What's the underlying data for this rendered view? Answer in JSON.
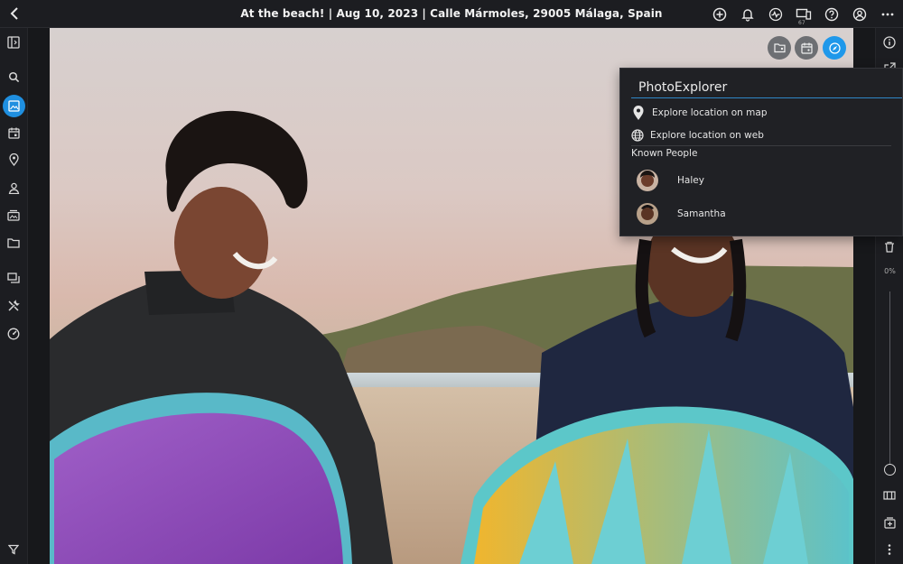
{
  "header": {
    "title": "At the beach! | Aug 10, 2023 | Calle Mármoles, 29005 Málaga, Spain",
    "upload_badge": "67",
    "icons": [
      "chevron-left-icon",
      "add-circle-icon",
      "bell-icon",
      "activity-icon",
      "devices-icon",
      "help-icon",
      "account-icon",
      "more-horizontal-icon"
    ]
  },
  "left_sidebar": {
    "items": [
      "sidebar-toggle-icon",
      "search-icon",
      "photos-icon",
      "calendar-icon",
      "places-icon",
      "people-icon",
      "albums-icon",
      "folder-icon",
      "library-icon",
      "tools-icon",
      "dashboard-icon",
      "filter-icon"
    ],
    "active": "photos-icon"
  },
  "right_sidebar": {
    "zoom_label": "0%",
    "zoom_value": 0,
    "icons": [
      "info-icon",
      "share-icon",
      "delete-icon",
      "compare-icon",
      "add-to-album-icon",
      "more-vertical-icon"
    ]
  },
  "photo_actions": {
    "icons": [
      "folder-location-icon",
      "calendar-location-icon",
      "compass-icon"
    ]
  },
  "popup": {
    "title": "PhotoExplorer",
    "explore_map": "Explore location on map",
    "explore_web": "Explore location on web",
    "known_people_label": "Known People",
    "people": [
      {
        "name": "Haley"
      },
      {
        "name": "Samantha"
      }
    ]
  },
  "colors": {
    "accent": "#1f98ea",
    "background": "#17181b",
    "panel": "#1c1d21"
  }
}
